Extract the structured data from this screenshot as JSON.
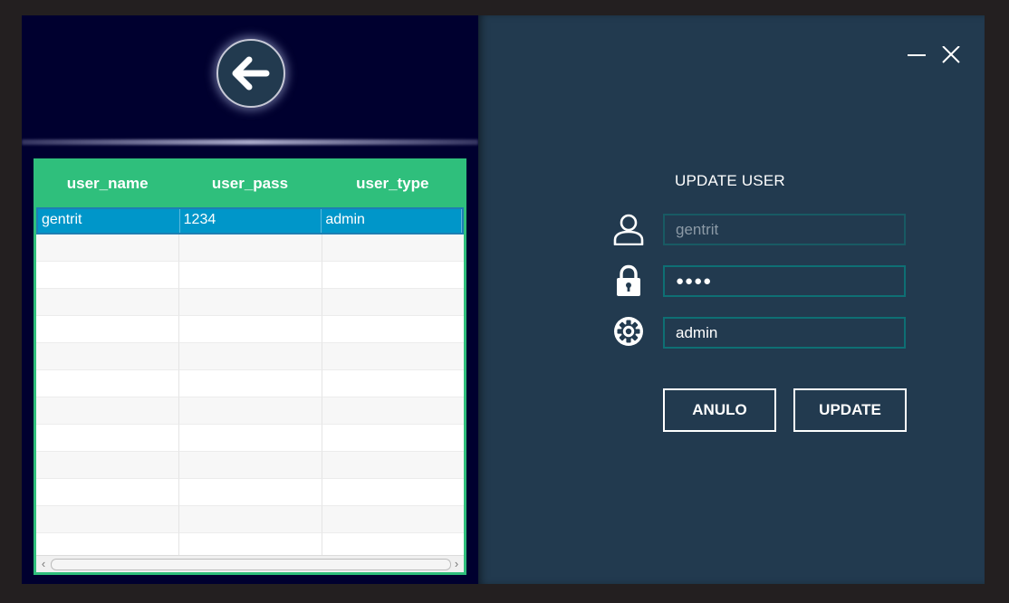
{
  "colors": {
    "left_panel_bg": "#00002f",
    "right_panel_bg": "#223a4f",
    "table_header_bg": "#2fbf7c",
    "selected_row_bg": "#0096c9",
    "field_border": "#0e6f74"
  },
  "back_button": {
    "icon": "arrow-left-icon"
  },
  "window_controls": {
    "minimize_icon": "minimize-icon",
    "close_icon": "close-icon"
  },
  "table": {
    "columns": [
      "user_name",
      "user_pass",
      "user_type"
    ],
    "rows": [
      [
        "gentrit",
        "1234",
        "admin"
      ],
      [
        "",
        "",
        ""
      ],
      [
        "",
        "",
        ""
      ],
      [
        "",
        "",
        ""
      ],
      [
        "",
        "",
        ""
      ],
      [
        "",
        "",
        ""
      ],
      [
        "",
        "",
        ""
      ],
      [
        "",
        "",
        ""
      ],
      [
        "",
        "",
        ""
      ],
      [
        "",
        "",
        ""
      ],
      [
        "",
        "",
        ""
      ],
      [
        "",
        "",
        ""
      ],
      [
        "",
        "",
        ""
      ]
    ],
    "selected_row": 0
  },
  "form": {
    "title": "UPDATE USER",
    "username": {
      "value": "gentrit",
      "icon": "user-icon"
    },
    "password": {
      "value": "●●●●",
      "icon": "lock-icon"
    },
    "user_type": {
      "value": "admin",
      "icon": "gear-icon"
    },
    "cancel_label": "ANULO",
    "update_label": "UPDATE"
  }
}
